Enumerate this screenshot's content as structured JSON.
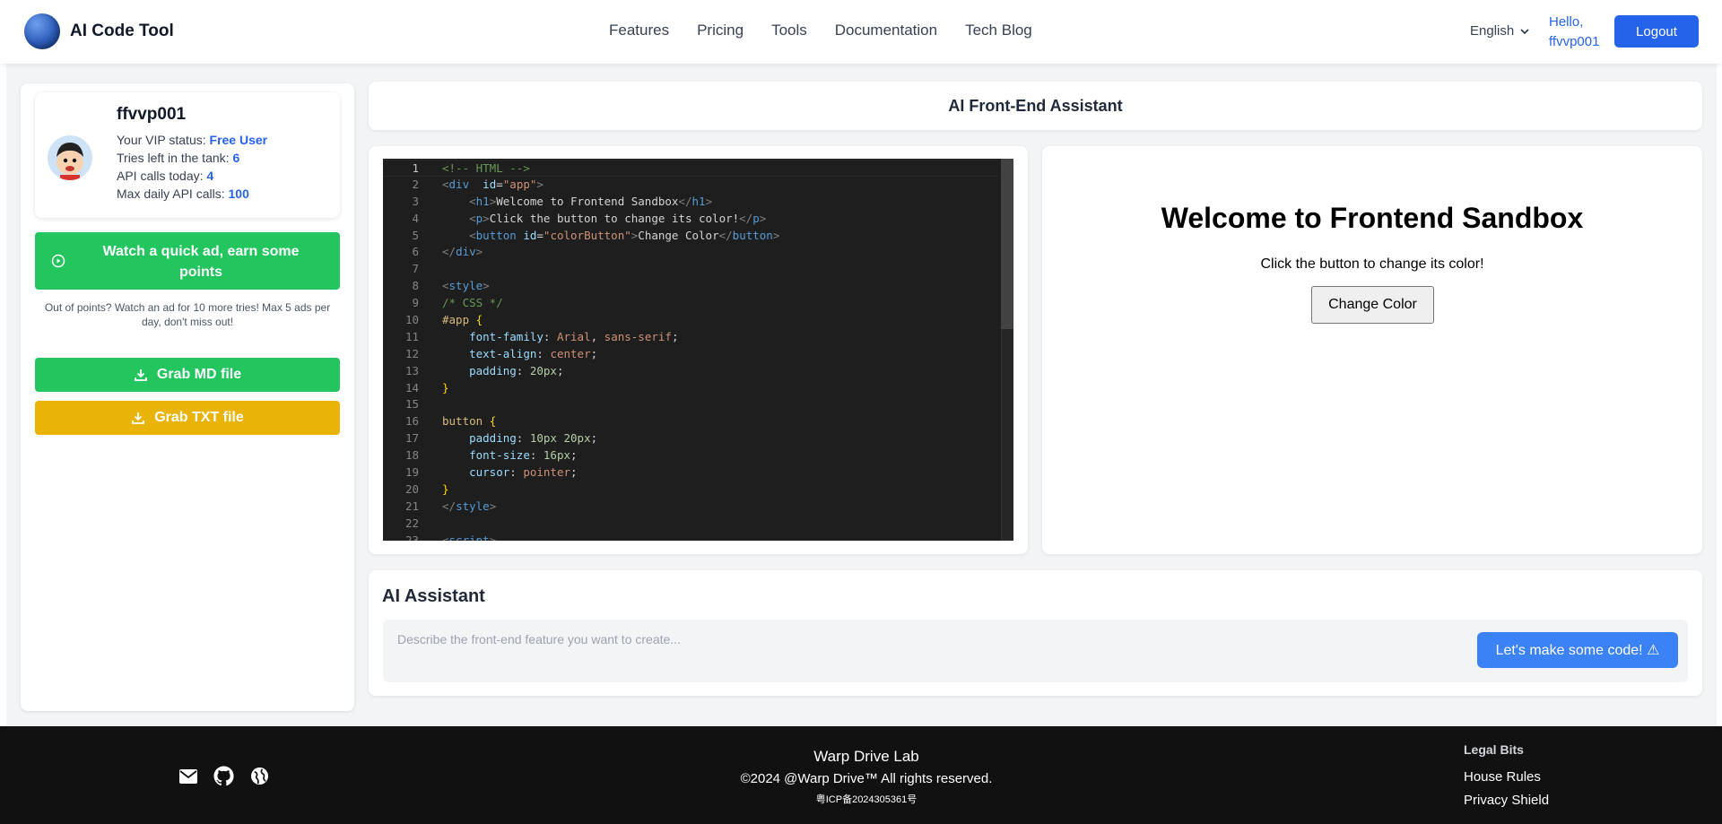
{
  "header": {
    "brand": "AI Code Tool",
    "nav": [
      "Features",
      "Pricing",
      "Tools",
      "Documentation",
      "Tech Blog"
    ],
    "language": "English",
    "greeting": "Hello,",
    "username": "ffvvp001",
    "logout_label": "Logout"
  },
  "profile": {
    "name": "ffvvp001",
    "vip_label": "Your VIP status:",
    "vip_value": "Free User",
    "tries_label": "Tries left in the tank:",
    "tries_value": "6",
    "api_today_label": "API calls today:",
    "api_today_value": "4",
    "max_api_label": "Max daily API calls:",
    "max_api_value": "100"
  },
  "sidebar": {
    "ad_button": "Watch a quick ad, earn some points",
    "ad_note": "Out of points? Watch an ad for 10 more tries! Max 5 ads per day, don't miss out!",
    "md_button": "Grab MD file",
    "txt_button": "Grab TXT file"
  },
  "main": {
    "title": "AI Front-End Assistant"
  },
  "editor": {
    "lines": [
      [
        [
          "c-cm",
          "<!-- HTML -->"
        ]
      ],
      [
        [
          "c-br",
          "<"
        ],
        [
          "c-tag",
          "div"
        ],
        [
          "",
          "  "
        ],
        [
          "c-at",
          "id"
        ],
        [
          "",
          "="
        ],
        [
          "c-str",
          "\"app\""
        ],
        [
          "c-br",
          ">"
        ]
      ],
      [
        [
          "",
          "    "
        ],
        [
          "c-br",
          "<"
        ],
        [
          "c-tag",
          "h1"
        ],
        [
          "c-br",
          ">"
        ],
        [
          "",
          "Welcome to Frontend Sandbox"
        ],
        [
          "c-br",
          "</"
        ],
        [
          "c-tag",
          "h1"
        ],
        [
          "c-br",
          ">"
        ]
      ],
      [
        [
          "",
          "    "
        ],
        [
          "c-br",
          "<"
        ],
        [
          "c-tag",
          "p"
        ],
        [
          "c-br",
          ">"
        ],
        [
          "",
          "Click the button to change its color!"
        ],
        [
          "c-br",
          "</"
        ],
        [
          "c-tag",
          "p"
        ],
        [
          "c-br",
          ">"
        ]
      ],
      [
        [
          "",
          "    "
        ],
        [
          "c-br",
          "<"
        ],
        [
          "c-tag",
          "button"
        ],
        [
          "",
          " "
        ],
        [
          "c-at",
          "id"
        ],
        [
          "",
          "="
        ],
        [
          "c-str",
          "\"colorButton\""
        ],
        [
          "c-br",
          ">"
        ],
        [
          "",
          "Change Color"
        ],
        [
          "c-br",
          "</"
        ],
        [
          "c-tag",
          "button"
        ],
        [
          "c-br",
          ">"
        ]
      ],
      [
        [
          "c-br",
          "</"
        ],
        [
          "c-tag",
          "div"
        ],
        [
          "c-br",
          ">"
        ]
      ],
      [],
      [
        [
          "c-br",
          "<"
        ],
        [
          "c-tag",
          "style"
        ],
        [
          "c-br",
          ">"
        ]
      ],
      [
        [
          "c-cm",
          "/* CSS */"
        ]
      ],
      [
        [
          "c-sel",
          "#app"
        ],
        [
          "",
          " "
        ],
        [
          "c-brace",
          "{"
        ]
      ],
      [
        [
          "",
          "    "
        ],
        [
          "c-pr",
          "font-family"
        ],
        [
          "",
          ": "
        ],
        [
          "c-str",
          "Arial"
        ],
        [
          "",
          ", "
        ],
        [
          "c-str",
          "sans-serif"
        ],
        [
          "",
          ";"
        ]
      ],
      [
        [
          "",
          "    "
        ],
        [
          "c-pr",
          "text-align"
        ],
        [
          "",
          ": "
        ],
        [
          "c-str",
          "center"
        ],
        [
          "",
          ";"
        ]
      ],
      [
        [
          "",
          "    "
        ],
        [
          "c-pr",
          "padding"
        ],
        [
          "",
          ": "
        ],
        [
          "c-num",
          "20px"
        ],
        [
          "",
          ";"
        ]
      ],
      [
        [
          "c-brace",
          "}"
        ]
      ],
      [],
      [
        [
          "c-sel",
          "button"
        ],
        [
          "",
          " "
        ],
        [
          "c-brace",
          "{"
        ]
      ],
      [
        [
          "",
          "    "
        ],
        [
          "c-pr",
          "padding"
        ],
        [
          "",
          ": "
        ],
        [
          "c-num",
          "10px 20px"
        ],
        [
          "",
          ";"
        ]
      ],
      [
        [
          "",
          "    "
        ],
        [
          "c-pr",
          "font-size"
        ],
        [
          "",
          ": "
        ],
        [
          "c-num",
          "16px"
        ],
        [
          "",
          ";"
        ]
      ],
      [
        [
          "",
          "    "
        ],
        [
          "c-pr",
          "cursor"
        ],
        [
          "",
          ": "
        ],
        [
          "c-str",
          "pointer"
        ],
        [
          "",
          ";"
        ]
      ],
      [
        [
          "c-brace",
          "}"
        ]
      ],
      [
        [
          "c-br",
          "</"
        ],
        [
          "c-tag",
          "style"
        ],
        [
          "c-br",
          ">"
        ]
      ],
      [],
      [
        [
          "c-br",
          "<"
        ],
        [
          "c-tag",
          "script"
        ],
        [
          "c-br",
          ">"
        ]
      ]
    ]
  },
  "preview": {
    "heading": "Welcome to Frontend Sandbox",
    "paragraph": "Click the button to change its color!",
    "button": "Change Color"
  },
  "ai": {
    "title": "AI Assistant",
    "placeholder": "Describe the front-end feature you want to create...",
    "button": "Let's make some code! ⚠"
  },
  "footer": {
    "company": "Warp Drive Lab",
    "copyright": "©2024 @Warp Drive™ All rights reserved.",
    "icp": "粤ICP备2024305361号",
    "legal_heading": "Legal Bits",
    "legal_links": [
      "House Rules",
      "Privacy Shield"
    ],
    "icons": [
      "mail-icon",
      "github-icon",
      "globe-icon"
    ]
  },
  "colors": {
    "primary": "#2563eb",
    "green": "#22c55e",
    "yellow": "#eab308",
    "ai_button": "#3b82f6",
    "footer_bg": "#111111"
  }
}
